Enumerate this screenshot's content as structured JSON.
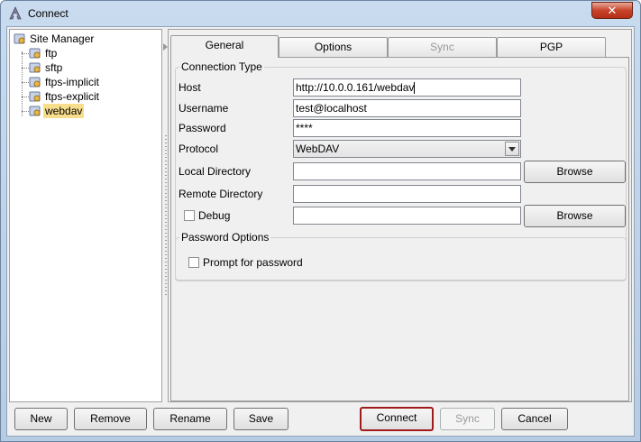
{
  "window": {
    "title": "Connect",
    "close_label": "✕"
  },
  "tree": {
    "root": "Site Manager",
    "items": [
      "ftp",
      "sftp",
      "ftps-implicit",
      "ftps-explicit",
      "webdav"
    ],
    "selected": "webdav"
  },
  "tabs": [
    {
      "label": "General",
      "state": "active"
    },
    {
      "label": "Options",
      "state": "normal"
    },
    {
      "label": "Sync",
      "state": "disabled"
    },
    {
      "label": "PGP",
      "state": "normal"
    }
  ],
  "connection": {
    "group_title": "Connection Type",
    "host_label": "Host",
    "host_value": "http://10.0.0.161/webdav",
    "username_label": "Username",
    "username_value": "test@localhost",
    "password_label": "Password",
    "password_value": "****",
    "protocol_label": "Protocol",
    "protocol_value": "WebDAV",
    "local_dir_label": "Local Directory",
    "local_dir_value": "",
    "browse_label": "Browse",
    "remote_dir_label": "Remote Directory",
    "remote_dir_value": "",
    "debug_label": "Debug",
    "debug_value": "",
    "browse2_label": "Browse"
  },
  "password_options": {
    "group_title": "Password Options",
    "prompt_label": "Prompt for password"
  },
  "buttons": {
    "new": "New",
    "remove": "Remove",
    "rename": "Rename",
    "save": "Save",
    "connect": "Connect",
    "sync": "Sync",
    "cancel": "Cancel"
  },
  "colors": {
    "selection": "#f7dd8c",
    "default_button_border": "#a01a1a",
    "title_gradient": "#c9dbee"
  }
}
